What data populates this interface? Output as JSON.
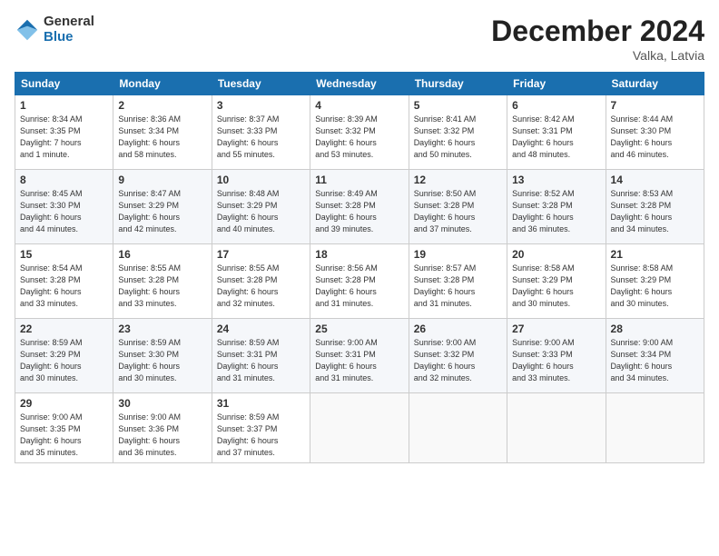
{
  "logo": {
    "general": "General",
    "blue": "Blue"
  },
  "title": "December 2024",
  "subtitle": "Valka, Latvia",
  "days_header": [
    "Sunday",
    "Monday",
    "Tuesday",
    "Wednesday",
    "Thursday",
    "Friday",
    "Saturday"
  ],
  "weeks": [
    [
      {
        "day": "1",
        "info": "Sunrise: 8:34 AM\nSunset: 3:35 PM\nDaylight: 7 hours\nand 1 minute."
      },
      {
        "day": "2",
        "info": "Sunrise: 8:36 AM\nSunset: 3:34 PM\nDaylight: 6 hours\nand 58 minutes."
      },
      {
        "day": "3",
        "info": "Sunrise: 8:37 AM\nSunset: 3:33 PM\nDaylight: 6 hours\nand 55 minutes."
      },
      {
        "day": "4",
        "info": "Sunrise: 8:39 AM\nSunset: 3:32 PM\nDaylight: 6 hours\nand 53 minutes."
      },
      {
        "day": "5",
        "info": "Sunrise: 8:41 AM\nSunset: 3:32 PM\nDaylight: 6 hours\nand 50 minutes."
      },
      {
        "day": "6",
        "info": "Sunrise: 8:42 AM\nSunset: 3:31 PM\nDaylight: 6 hours\nand 48 minutes."
      },
      {
        "day": "7",
        "info": "Sunrise: 8:44 AM\nSunset: 3:30 PM\nDaylight: 6 hours\nand 46 minutes."
      }
    ],
    [
      {
        "day": "8",
        "info": "Sunrise: 8:45 AM\nSunset: 3:30 PM\nDaylight: 6 hours\nand 44 minutes."
      },
      {
        "day": "9",
        "info": "Sunrise: 8:47 AM\nSunset: 3:29 PM\nDaylight: 6 hours\nand 42 minutes."
      },
      {
        "day": "10",
        "info": "Sunrise: 8:48 AM\nSunset: 3:29 PM\nDaylight: 6 hours\nand 40 minutes."
      },
      {
        "day": "11",
        "info": "Sunrise: 8:49 AM\nSunset: 3:28 PM\nDaylight: 6 hours\nand 39 minutes."
      },
      {
        "day": "12",
        "info": "Sunrise: 8:50 AM\nSunset: 3:28 PM\nDaylight: 6 hours\nand 37 minutes."
      },
      {
        "day": "13",
        "info": "Sunrise: 8:52 AM\nSunset: 3:28 PM\nDaylight: 6 hours\nand 36 minutes."
      },
      {
        "day": "14",
        "info": "Sunrise: 8:53 AM\nSunset: 3:28 PM\nDaylight: 6 hours\nand 34 minutes."
      }
    ],
    [
      {
        "day": "15",
        "info": "Sunrise: 8:54 AM\nSunset: 3:28 PM\nDaylight: 6 hours\nand 33 minutes."
      },
      {
        "day": "16",
        "info": "Sunrise: 8:55 AM\nSunset: 3:28 PM\nDaylight: 6 hours\nand 33 minutes."
      },
      {
        "day": "17",
        "info": "Sunrise: 8:55 AM\nSunset: 3:28 PM\nDaylight: 6 hours\nand 32 minutes."
      },
      {
        "day": "18",
        "info": "Sunrise: 8:56 AM\nSunset: 3:28 PM\nDaylight: 6 hours\nand 31 minutes."
      },
      {
        "day": "19",
        "info": "Sunrise: 8:57 AM\nSunset: 3:28 PM\nDaylight: 6 hours\nand 31 minutes."
      },
      {
        "day": "20",
        "info": "Sunrise: 8:58 AM\nSunset: 3:29 PM\nDaylight: 6 hours\nand 30 minutes."
      },
      {
        "day": "21",
        "info": "Sunrise: 8:58 AM\nSunset: 3:29 PM\nDaylight: 6 hours\nand 30 minutes."
      }
    ],
    [
      {
        "day": "22",
        "info": "Sunrise: 8:59 AM\nSunset: 3:29 PM\nDaylight: 6 hours\nand 30 minutes."
      },
      {
        "day": "23",
        "info": "Sunrise: 8:59 AM\nSunset: 3:30 PM\nDaylight: 6 hours\nand 30 minutes."
      },
      {
        "day": "24",
        "info": "Sunrise: 8:59 AM\nSunset: 3:31 PM\nDaylight: 6 hours\nand 31 minutes."
      },
      {
        "day": "25",
        "info": "Sunrise: 9:00 AM\nSunset: 3:31 PM\nDaylight: 6 hours\nand 31 minutes."
      },
      {
        "day": "26",
        "info": "Sunrise: 9:00 AM\nSunset: 3:32 PM\nDaylight: 6 hours\nand 32 minutes."
      },
      {
        "day": "27",
        "info": "Sunrise: 9:00 AM\nSunset: 3:33 PM\nDaylight: 6 hours\nand 33 minutes."
      },
      {
        "day": "28",
        "info": "Sunrise: 9:00 AM\nSunset: 3:34 PM\nDaylight: 6 hours\nand 34 minutes."
      }
    ],
    [
      {
        "day": "29",
        "info": "Sunrise: 9:00 AM\nSunset: 3:35 PM\nDaylight: 6 hours\nand 35 minutes."
      },
      {
        "day": "30",
        "info": "Sunrise: 9:00 AM\nSunset: 3:36 PM\nDaylight: 6 hours\nand 36 minutes."
      },
      {
        "day": "31",
        "info": "Sunrise: 8:59 AM\nSunset: 3:37 PM\nDaylight: 6 hours\nand 37 minutes."
      },
      {
        "day": "",
        "info": ""
      },
      {
        "day": "",
        "info": ""
      },
      {
        "day": "",
        "info": ""
      },
      {
        "day": "",
        "info": ""
      }
    ]
  ]
}
